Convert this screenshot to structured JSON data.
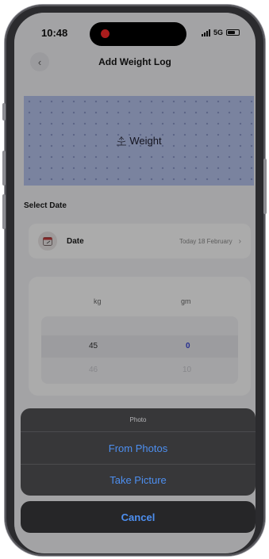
{
  "status_bar": {
    "time": "10:48",
    "network": "5G"
  },
  "nav": {
    "title": "Add Weight Log"
  },
  "banner": {
    "label": "Weight"
  },
  "date_section": {
    "heading": "Select Date",
    "label": "Date",
    "value": "Today 18 February"
  },
  "picker": {
    "columns": [
      "kg",
      "gm"
    ],
    "rows": [
      {
        "kg": "45",
        "gm": "0"
      },
      {
        "kg": "46",
        "gm": "10"
      }
    ]
  },
  "action_sheet": {
    "title": "Photo",
    "options": [
      "From Photos",
      "Take Picture"
    ],
    "cancel": "Cancel"
  },
  "colors": {
    "accent": "#4d8ff0",
    "banner": "#b7c4ee",
    "selected_value": "#3a46d6"
  }
}
